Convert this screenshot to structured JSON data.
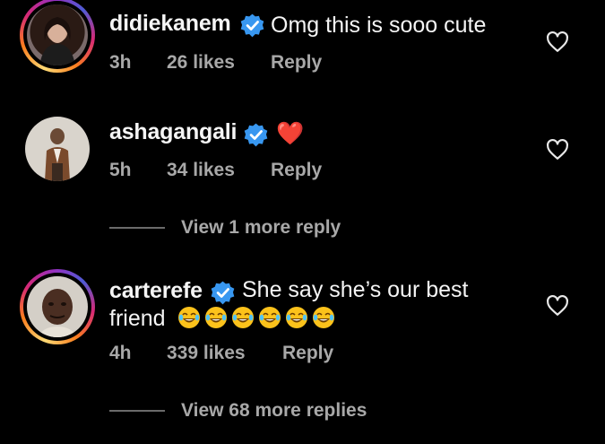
{
  "comments": [
    {
      "username": "didiekanem",
      "text": "Omg this is sooo cute",
      "time": "3h",
      "likes": "26 likes",
      "reply": "Reply"
    },
    {
      "username": "ashagangali",
      "text": "❤️",
      "time": "5h",
      "likes": "34 likes",
      "reply": "Reply",
      "view_replies": "View 1 more reply"
    },
    {
      "username": "carterefe",
      "text_line1": "She say she’s our best",
      "text_line2": "friend",
      "emojis": [
        "face-with-tears-of-joy",
        "face-with-tears-of-joy",
        "face-with-tears-of-joy",
        "face-with-tears-of-joy",
        "face-with-tears-of-joy",
        "face-with-tears-of-joy"
      ],
      "time": "4h",
      "likes": "339 likes",
      "reply": "Reply",
      "view_replies": "View 68 more replies"
    }
  ],
  "icons": {
    "verified": "verified-badge-icon",
    "like": "heart-outline-icon"
  },
  "colors": {
    "background": "#000000",
    "verified_blue": "#3897f0",
    "secondary_text": "#a8a8a8",
    "heart_red": "#ed4956"
  }
}
